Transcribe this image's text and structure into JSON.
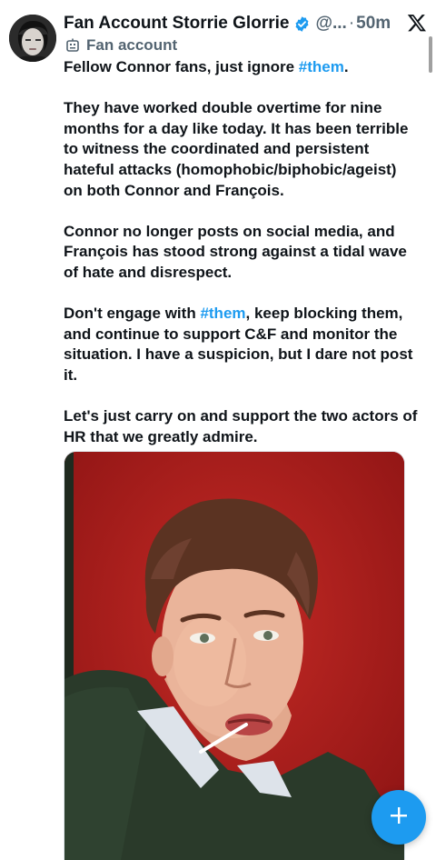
{
  "author": {
    "display_name": "Fan Account Storrie Glorrie",
    "handle": "@...",
    "separator": "·",
    "timestamp": "50m",
    "account_label": "Fan account"
  },
  "tweet": {
    "paragraphs": [
      [
        {
          "text": "Fellow Connor fans, just ignore "
        },
        {
          "text": "#them",
          "hashtag": true
        },
        {
          "text": "."
        }
      ],
      [
        {
          "text": "They have worked double overtime for nine months for a day like today. It has been terrible to witness the coordinated and persistent hateful attacks (homophobic/biphobic/ageist) on both Connor and François."
        }
      ],
      [
        {
          "text": "Connor no longer posts on social media, and François has stood strong against a tidal wave of hate and disrespect."
        }
      ],
      [
        {
          "text": "Don't engage with "
        },
        {
          "text": "#them",
          "hashtag": true
        },
        {
          "text": ", keep blocking them, and continue to support C&F and monitor the situation. I have a suspicion, but I dare not post it."
        }
      ],
      [
        {
          "text": "Let's just carry on and support the two actors of HR that we greatly admire."
        }
      ]
    ]
  },
  "colors": {
    "hashtag": "#1d9bf0",
    "verified": "#1d9bf0",
    "fab": "#1d9bf0",
    "photo_background": "#b81d1d",
    "muted_text": "#536471"
  },
  "icons": {
    "verified": "verified-badge-icon",
    "x_logo": "x-logo-icon",
    "account_label": "automated-account-icon",
    "fab": "plus-icon"
  }
}
